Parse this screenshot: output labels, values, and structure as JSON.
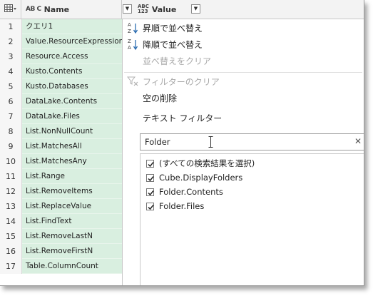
{
  "header": {
    "name_col_label": "Name",
    "name_type_label": "AB C",
    "value_col_label": "Value",
    "value_type_top": "ABC",
    "value_type_bottom": "123",
    "dropdown_glyph": "▼"
  },
  "rows": [
    {
      "num": "1",
      "name": "クエリ1"
    },
    {
      "num": "2",
      "name": "Value.ResourceExpression"
    },
    {
      "num": "3",
      "name": "Resource.Access"
    },
    {
      "num": "4",
      "name": "Kusto.Contents"
    },
    {
      "num": "5",
      "name": "Kusto.Databases"
    },
    {
      "num": "6",
      "name": "DataLake.Contents"
    },
    {
      "num": "7",
      "name": "DataLake.Files"
    },
    {
      "num": "8",
      "name": "List.NonNullCount"
    },
    {
      "num": "9",
      "name": "List.MatchesAll"
    },
    {
      "num": "10",
      "name": "List.MatchesAny"
    },
    {
      "num": "11",
      "name": "List.Range"
    },
    {
      "num": "12",
      "name": "List.RemoveItems"
    },
    {
      "num": "13",
      "name": "List.ReplaceValue"
    },
    {
      "num": "14",
      "name": "List.FindText"
    },
    {
      "num": "15",
      "name": "List.RemoveLastN"
    },
    {
      "num": "16",
      "name": "List.RemoveFirstN"
    },
    {
      "num": "17",
      "name": "Table.ColumnCount"
    }
  ],
  "menu": {
    "sort_asc": "昇順で並べ替え",
    "sort_desc": "降順で並べ替え",
    "clear_sort": "並べ替えをクリア",
    "clear_filter": "フィルターのクリア",
    "remove_empty": "空の削除",
    "text_filters": "テキスト フィルター",
    "search_value": "Folder",
    "clear_search_glyph": "✕",
    "options": [
      {
        "label": "(すべての検索結果を選択)",
        "checked": true
      },
      {
        "label": "Cube.DisplayFolders",
        "checked": true
      },
      {
        "label": "Folder.Contents",
        "checked": true
      },
      {
        "label": "Folder.Files",
        "checked": true
      }
    ]
  },
  "icons": {
    "table": "table-icon",
    "sort_asc": "sort-ascending-icon",
    "sort_desc": "sort-descending-icon",
    "clear_filter": "filter-clear-icon",
    "checkbox": "checkbox-checked-icon"
  },
  "colors": {
    "cell_highlight": "#d9efe0",
    "accent_blue": "#2b6cb0",
    "disabled_text": "#a8a8a8"
  }
}
